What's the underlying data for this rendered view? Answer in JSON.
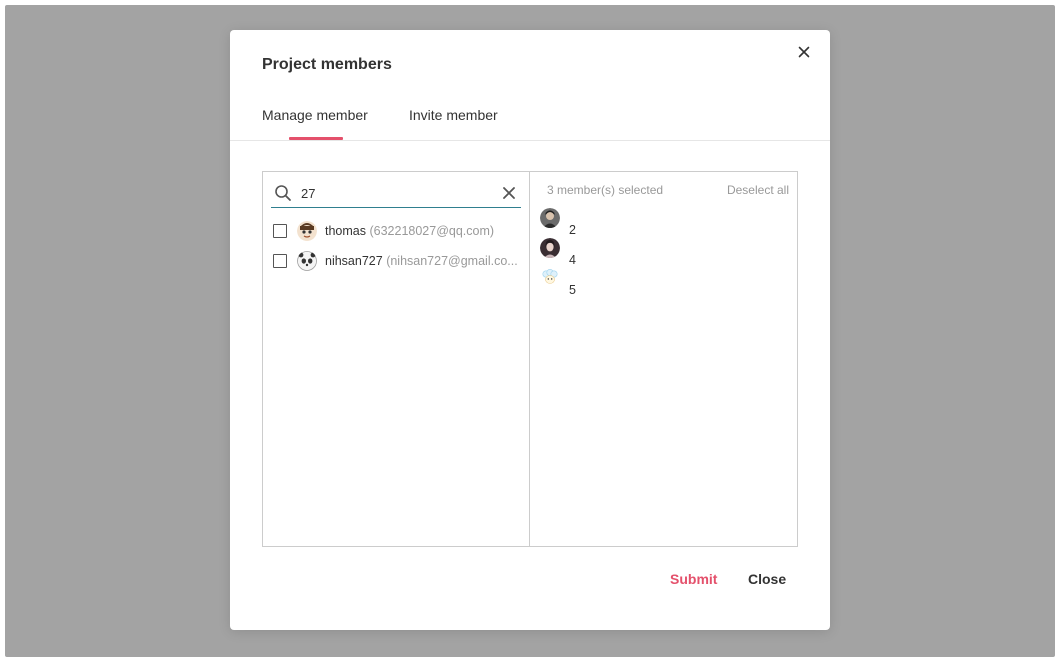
{
  "modal": {
    "title": "Project members",
    "close_icon": "close-icon"
  },
  "tabs": [
    {
      "label": "Manage member",
      "active": true
    },
    {
      "label": "Invite member",
      "active": false
    }
  ],
  "search": {
    "value": "27",
    "placeholder": "",
    "icon": "search-icon",
    "clear_icon": "clear-icon"
  },
  "results": [
    {
      "name": "thomas",
      "email": "(632218027@qq.com)",
      "checked": false,
      "avatar": "cartoon-face-avatar"
    },
    {
      "name": "nihsan727",
      "email": "(nihsan727@gmail.co...",
      "checked": false,
      "avatar": "panda-avatar"
    }
  ],
  "selected": {
    "count_label": "3 member(s) selected",
    "deselect_label": "Deselect all",
    "members": [
      {
        "name": "2",
        "avatar": "photo-avatar-man"
      },
      {
        "name": "4",
        "avatar": "photo-avatar-woman"
      },
      {
        "name": "5",
        "avatar": "cartoon-sheep-avatar"
      }
    ]
  },
  "footer": {
    "submit_label": "Submit",
    "close_label": "Close"
  },
  "colors": {
    "accent": "#e4506b",
    "focus_line": "#2f7f8f",
    "backdrop": "#a3a3a3"
  }
}
